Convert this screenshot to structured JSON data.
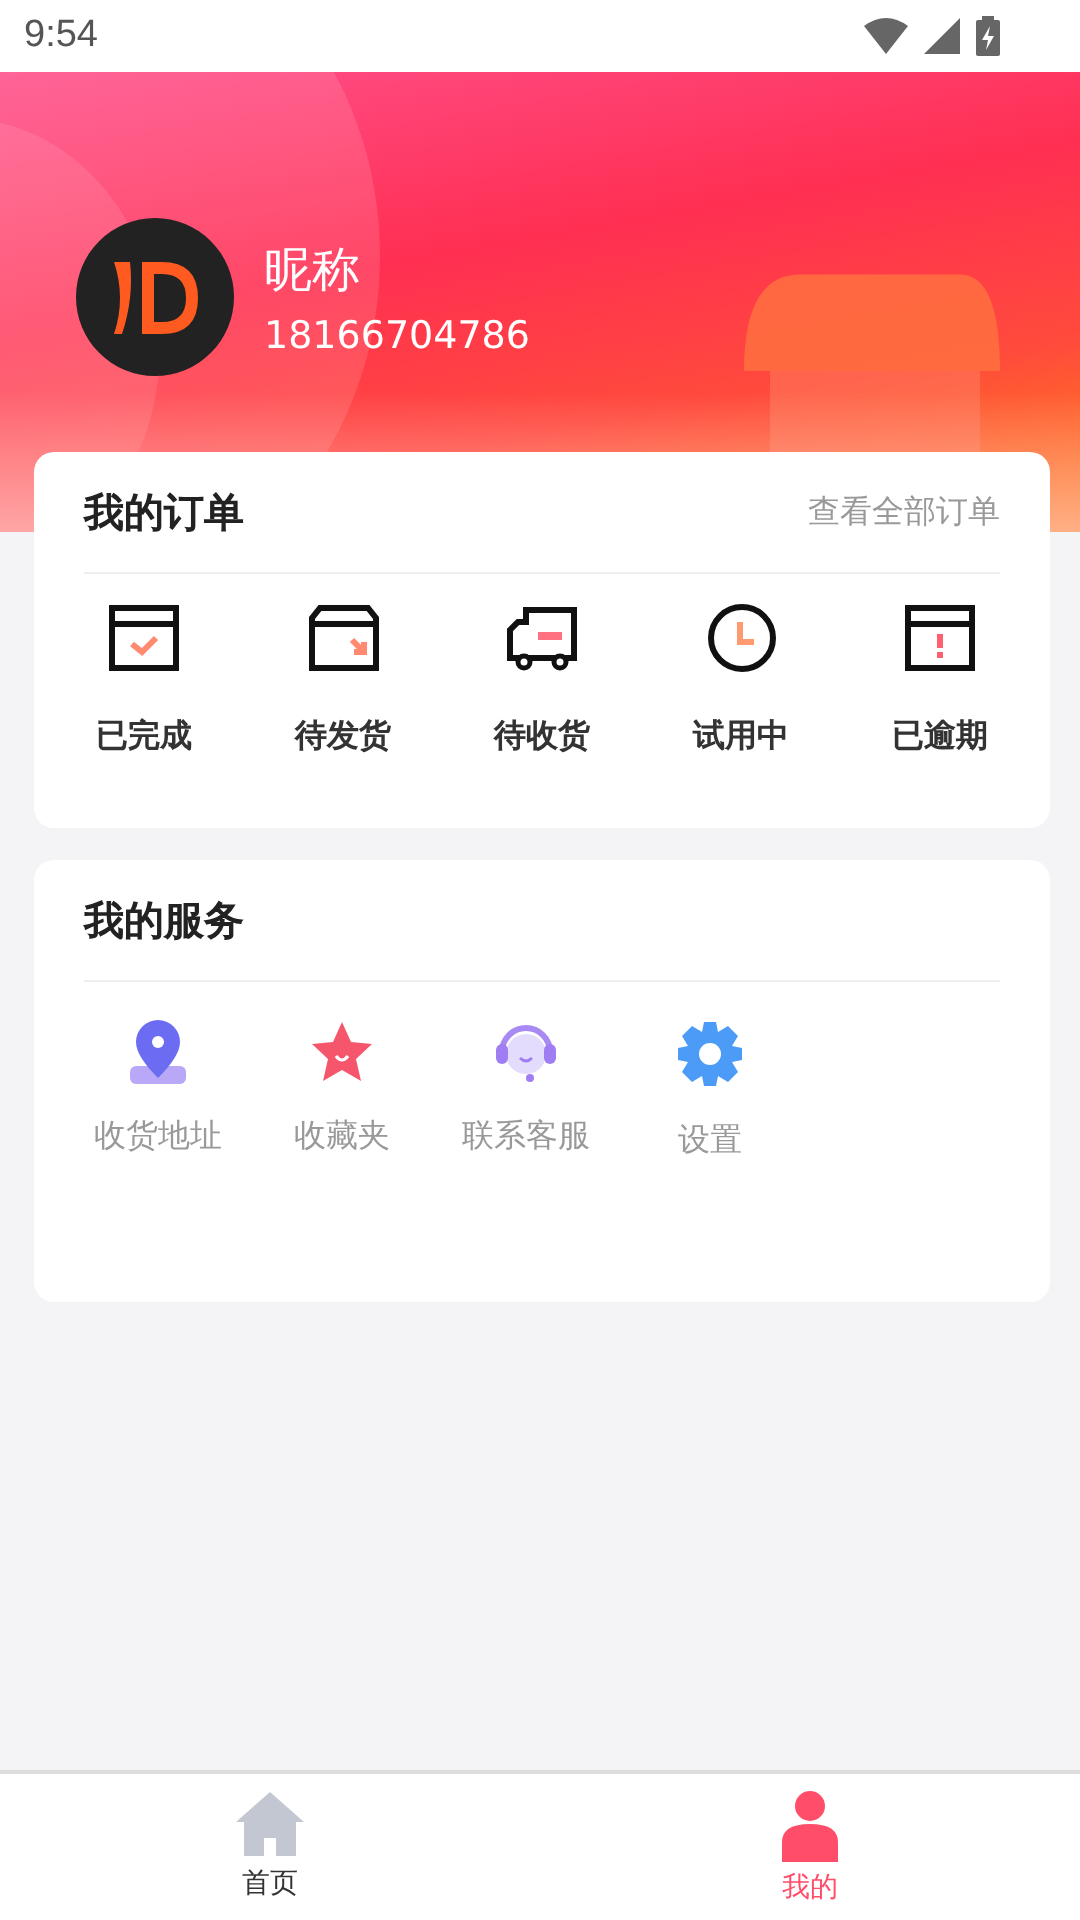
{
  "status_bar": {
    "time": "9:54"
  },
  "profile": {
    "nickname": "昵称",
    "phone": "18166704786"
  },
  "orders": {
    "title": "我的订单",
    "link": "查看全部订单",
    "items": [
      {
        "label": "已完成",
        "kind": "done"
      },
      {
        "label": "待发货",
        "kind": "ship"
      },
      {
        "label": "待收货",
        "kind": "truck"
      },
      {
        "label": "试用中",
        "kind": "clock"
      },
      {
        "label": "已逾期",
        "kind": "overdue"
      }
    ]
  },
  "services": {
    "title": "我的服务",
    "items": [
      {
        "label": "收货地址",
        "kind": "location"
      },
      {
        "label": "收藏夹",
        "kind": "star"
      },
      {
        "label": "联系客服",
        "kind": "support"
      },
      {
        "label": "设置",
        "kind": "settings"
      }
    ]
  },
  "tabs": [
    {
      "label": "首页",
      "kind": "home",
      "selected": false
    },
    {
      "label": "我的",
      "kind": "person",
      "selected": true
    }
  ]
}
